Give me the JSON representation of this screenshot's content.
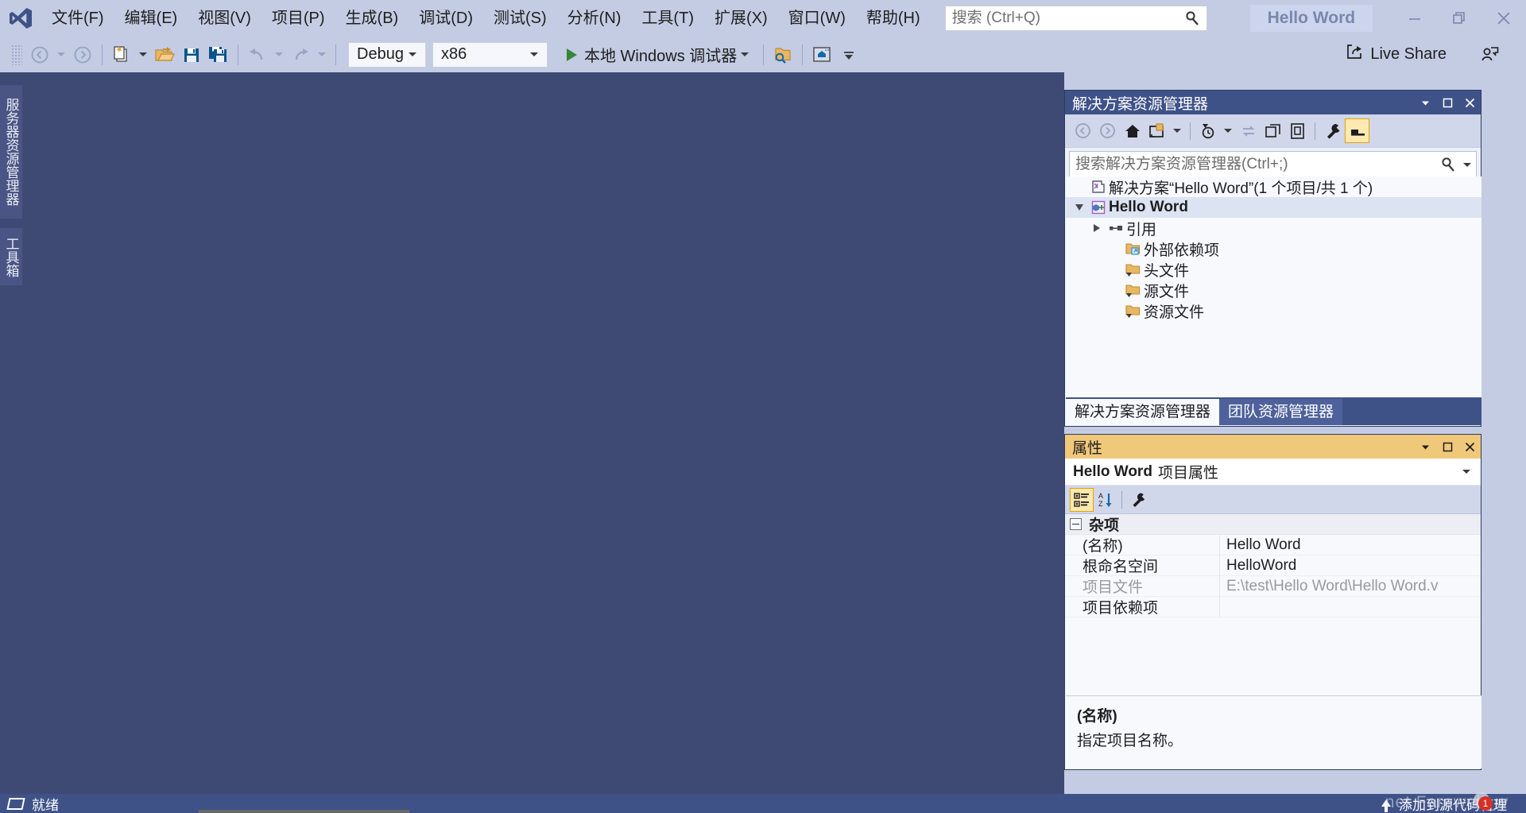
{
  "app": {
    "window_title": "Hello Word",
    "logo_icon": "visual-studio-logo-icon"
  },
  "menubar": {
    "items": [
      {
        "label": "文件(F)",
        "name": "menu-file"
      },
      {
        "label": "编辑(E)",
        "name": "menu-edit"
      },
      {
        "label": "视图(V)",
        "name": "menu-view"
      },
      {
        "label": "项目(P)",
        "name": "menu-project"
      },
      {
        "label": "生成(B)",
        "name": "menu-build"
      },
      {
        "label": "调试(D)",
        "name": "menu-debug"
      },
      {
        "label": "测试(S)",
        "name": "menu-test"
      },
      {
        "label": "分析(N)",
        "name": "menu-analyze"
      },
      {
        "label": "工具(T)",
        "name": "menu-tools"
      },
      {
        "label": "扩展(X)",
        "name": "menu-extensions"
      },
      {
        "label": "窗口(W)",
        "name": "menu-window"
      },
      {
        "label": "帮助(H)",
        "name": "menu-help"
      }
    ]
  },
  "quick_search": {
    "placeholder": "搜索 (Ctrl+Q)",
    "value": "",
    "icon": "search-icon"
  },
  "window_controls": {
    "minimize": "minimize-icon",
    "restore": "restore-icon",
    "close": "close-icon"
  },
  "toolbar": {
    "config_value": "Debug",
    "platform_value": "x86",
    "run_label": "本地 Windows 调试器",
    "live_share_label": "Live Share",
    "icons": [
      "navigate-back-icon",
      "navigate-forward-icon",
      "new-project-icon",
      "open-file-icon",
      "save-icon",
      "save-all-icon",
      "undo-icon",
      "redo-icon",
      "play-icon",
      "find-in-files-icon",
      "start-window-icon",
      "overflow-icon",
      "live-share-icon",
      "share-user-icon"
    ]
  },
  "left_rail": {
    "tabs": [
      {
        "label": "服务器资源管理器",
        "name": "vtab-server-explorer"
      },
      {
        "label": "工具箱",
        "name": "vtab-toolbox"
      }
    ]
  },
  "solution_explorer": {
    "title": "解决方案资源管理器",
    "search": {
      "placeholder": "搜索解决方案资源管理器(Ctrl+;)",
      "value": ""
    },
    "toolbar_icons": [
      "back-icon",
      "forward-icon",
      "home-icon",
      "sync-with-active-document-icon",
      "chevron-down-icon",
      "pending-changes-filter-icon",
      "chevron-down-icon-2",
      "refresh-icon",
      "collapse-all-icon",
      "show-all-files-icon",
      "properties-wrench-icon",
      "preview-selected-items-icon"
    ],
    "tree": [
      {
        "label": "解决方案“Hello Word”(1 个项目/共 1 个)",
        "icon": "solution-icon",
        "depth": 0,
        "expander": "none",
        "selected": false
      },
      {
        "label": "Hello Word",
        "icon": "cpp-project-icon",
        "depth": 1,
        "expander": "expanded",
        "selected": true
      },
      {
        "label": "引用",
        "icon": "references-icon",
        "depth": 2,
        "expander": "collapsed",
        "selected": false
      },
      {
        "label": "外部依赖项",
        "icon": "external-dependencies-folder-icon",
        "depth": 3,
        "expander": "none",
        "selected": false
      },
      {
        "label": "头文件",
        "icon": "filter-folder-icon",
        "depth": 3,
        "expander": "none",
        "selected": false
      },
      {
        "label": "源文件",
        "icon": "filter-folder-icon",
        "depth": 3,
        "expander": "none",
        "selected": false
      },
      {
        "label": "资源文件",
        "icon": "filter-folder-icon",
        "depth": 3,
        "expander": "none",
        "selected": false
      }
    ],
    "tabs": [
      {
        "label": "解决方案资源管理器",
        "active": true
      },
      {
        "label": "团队资源管理器",
        "active": false
      }
    ]
  },
  "properties": {
    "title": "属性",
    "object_name": "Hello Word",
    "object_kind": "项目属性",
    "toolbar_icons": [
      "categorized-icon",
      "alphabetical-sort-icon",
      "property-pages-wrench-icon"
    ],
    "category": "杂项",
    "rows": [
      {
        "key": "(名称)",
        "value": "Hello Word",
        "readonly": false
      },
      {
        "key": "根命名空间",
        "value": "HelloWord",
        "readonly": false
      },
      {
        "key": "项目文件",
        "value": "E:\\test\\Hello Word\\Hello Word.v",
        "readonly": true
      },
      {
        "key": "项目依赖项",
        "value": "",
        "readonly": false
      }
    ],
    "description": {
      "title": "(名称)",
      "text": "指定项目名称。"
    }
  },
  "statusbar": {
    "status_text": "就绪",
    "source_control_label": "添加到源代码管理",
    "watermark_text": "net Farewell_w",
    "notification_count": "1",
    "icons": [
      "ready-flag-icon",
      "add-to-source-control-icon"
    ]
  },
  "colors": {
    "chrome": "#c3cce3",
    "panel_header_blue": "#3f5288",
    "properties_header_gold": "#f0c87a",
    "editor_void": "#3f4a74",
    "statusbar": "#3f5288",
    "accent_orange": "#e6a200",
    "run_green": "#39853a"
  }
}
